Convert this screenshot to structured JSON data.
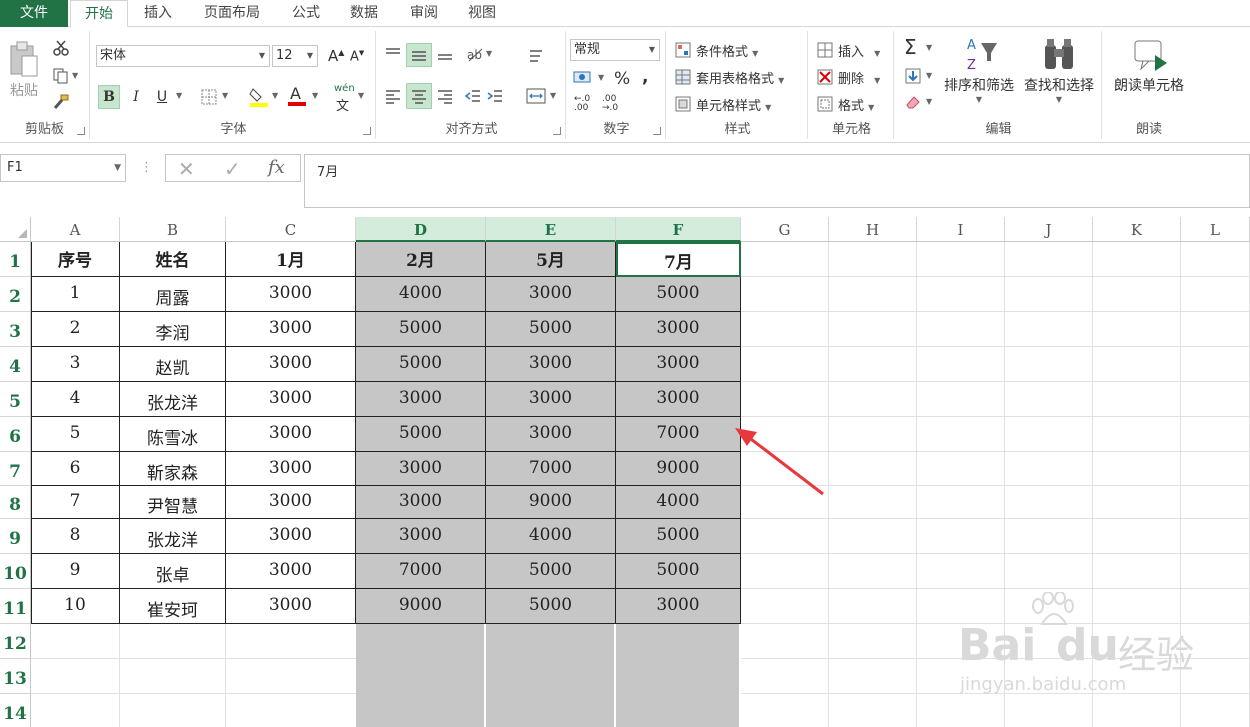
{
  "ribbon_tabs": [
    "文件",
    "开始",
    "插入",
    "页面布局",
    "公式",
    "数据",
    "审阅",
    "视图"
  ],
  "clipboard": {
    "paste": "粘贴",
    "group": "剪贴板"
  },
  "font": {
    "name": "宋体",
    "size": "12",
    "group": "字体",
    "bold": "B",
    "italic": "I",
    "underline": "U",
    "phonetic": "wén"
  },
  "alignment": {
    "group": "对齐方式"
  },
  "number": {
    "format": "常规",
    "percent": "%",
    "comma": ",",
    "group": "数字"
  },
  "styles": {
    "conditional": "条件格式",
    "table": "套用表格格式",
    "cell_styles": "单元格样式",
    "group": "样式"
  },
  "cells": {
    "insert": "插入",
    "delete": "删除",
    "format": "格式",
    "group": "单元格"
  },
  "editing": {
    "sort_filter": "排序和筛选",
    "find_select": "查找和选择",
    "group": "编辑"
  },
  "speech": {
    "read_cell": "朗读单元格",
    "group": "朗读"
  },
  "formula_bar": {
    "name_box": "F1",
    "fx": "fx",
    "formula": "7月"
  },
  "columns": [
    "A",
    "B",
    "C",
    "D",
    "E",
    "F",
    "G",
    "H",
    "I",
    "J",
    "K",
    "L"
  ],
  "rows": [
    "1",
    "2",
    "3",
    "4",
    "5",
    "6",
    "7",
    "8",
    "9",
    "10",
    "11",
    "12",
    "13",
    "14"
  ],
  "headers": [
    "序号",
    "姓名",
    "1月",
    "2月",
    "5月",
    "7月"
  ],
  "table": [
    [
      "1",
      "周露",
      "3000",
      "4000",
      "3000",
      "5000"
    ],
    [
      "2",
      "李润",
      "3000",
      "5000",
      "5000",
      "3000"
    ],
    [
      "3",
      "赵凯",
      "3000",
      "5000",
      "3000",
      "3000"
    ],
    [
      "4",
      "张龙洋",
      "3000",
      "3000",
      "3000",
      "3000"
    ],
    [
      "5",
      "陈雪冰",
      "3000",
      "5000",
      "3000",
      "7000"
    ],
    [
      "6",
      "靳家森",
      "3000",
      "3000",
      "7000",
      "9000"
    ],
    [
      "7",
      "尹智慧",
      "3000",
      "3000",
      "9000",
      "4000"
    ],
    [
      "8",
      "张龙洋",
      "3000",
      "3000",
      "4000",
      "5000"
    ],
    [
      "9",
      "张卓",
      "3000",
      "7000",
      "5000",
      "5000"
    ],
    [
      "10",
      "崔安珂",
      "3000",
      "9000",
      "5000",
      "3000"
    ]
  ],
  "watermark": {
    "brand": "Bai",
    "brand2": "du",
    "cn": "经验",
    "url": "jingyan.baidu.com"
  },
  "colors": {
    "accent": "#217346",
    "selection_fill": "#c6c6c6",
    "arrow": "#e8383d"
  }
}
